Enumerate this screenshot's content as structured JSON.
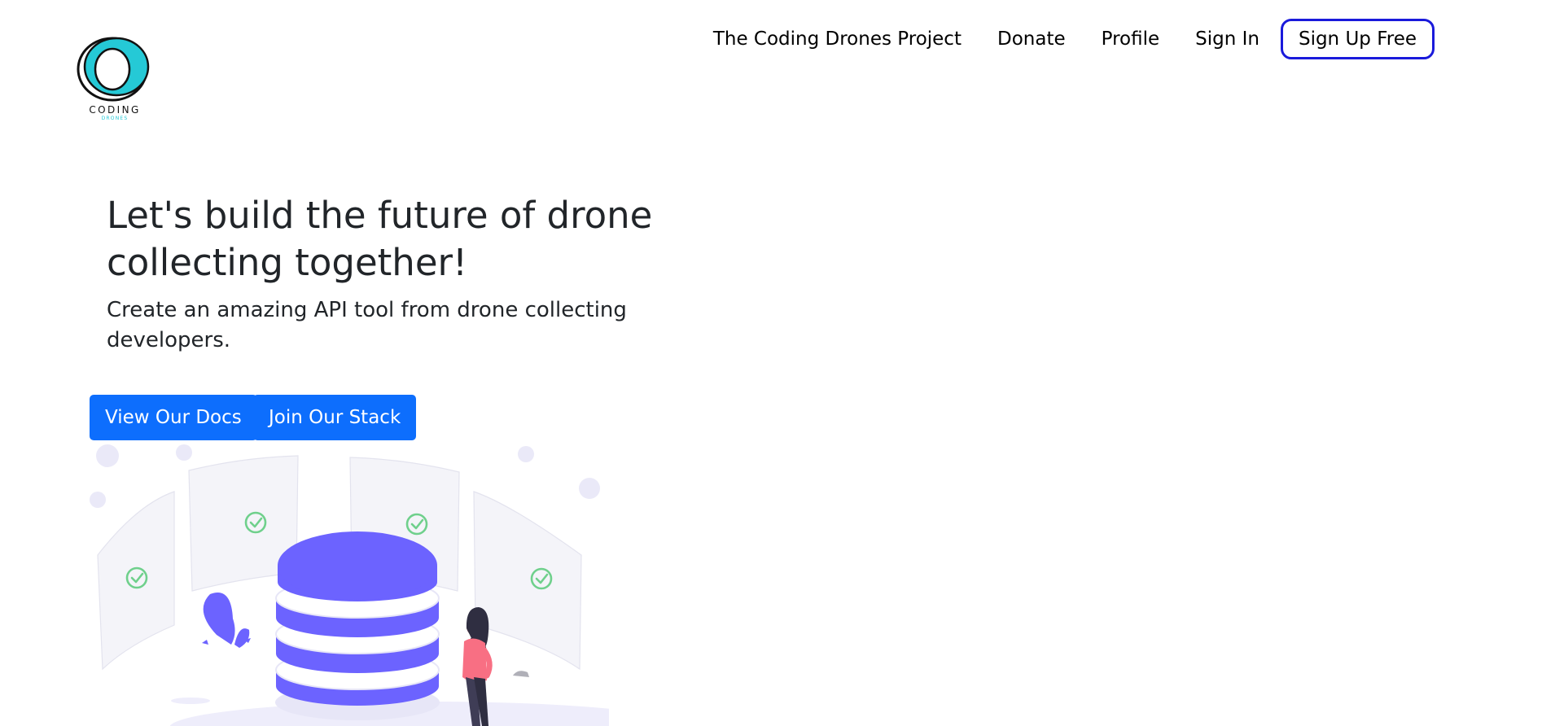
{
  "brand": {
    "name": "CODING",
    "tagline": "DRONES",
    "accent": "#25c9d6"
  },
  "nav": {
    "items": [
      "The Coding Drones Project",
      "Donate",
      "Profile",
      "Sign In"
    ],
    "signup_label": "Sign Up Free",
    "signup_border_color": "#1a1adb"
  },
  "hero": {
    "headline": "Let's build the future of drone collecting together!",
    "subheadline": "Create an amazing API tool from drone collecting developers.",
    "primary_button": "View Our Docs",
    "secondary_button": "Join Our Stack",
    "button_color": "#0d6efd"
  },
  "illustration": {
    "subject": "database server with approved panels and a woman standing",
    "primary_color": "#6c63ff",
    "check_color": "#6fd08c"
  }
}
